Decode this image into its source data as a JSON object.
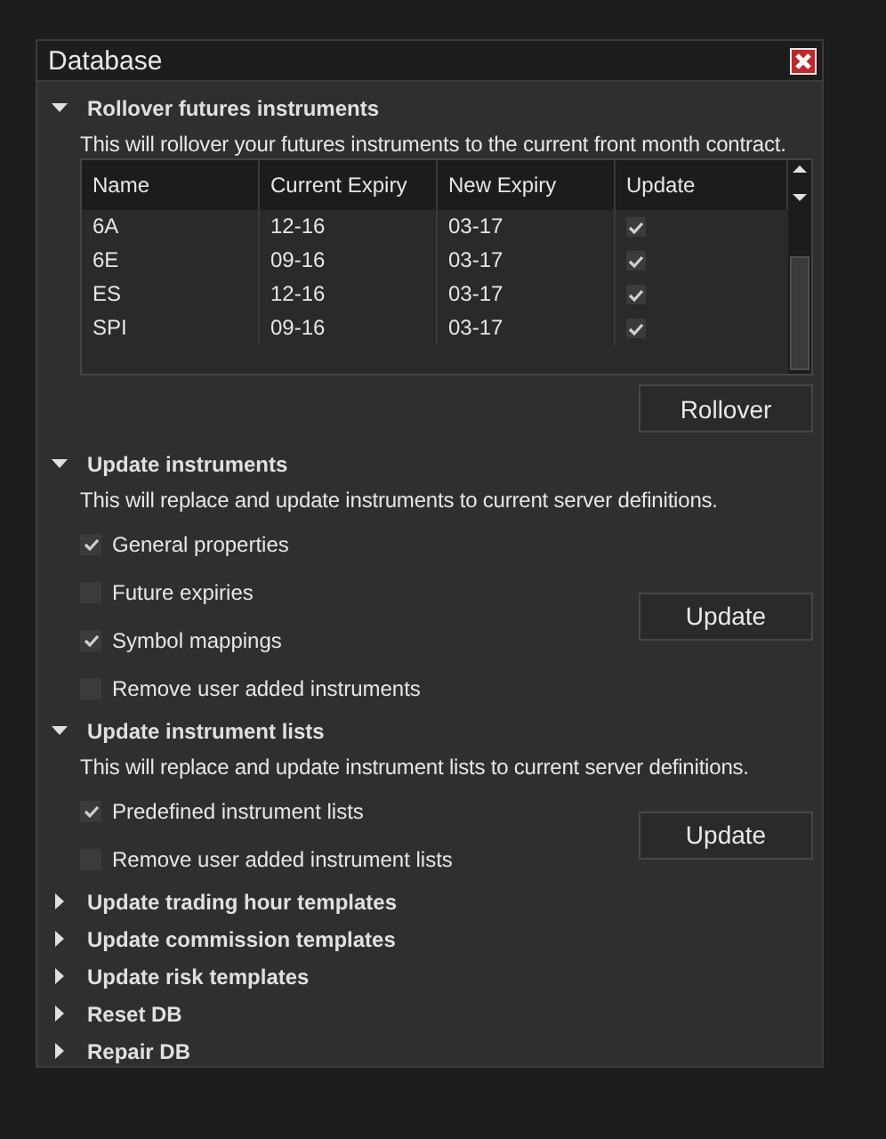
{
  "window": {
    "title": "Database"
  },
  "sections": [
    {
      "title": "Rollover futures instruments",
      "expanded": true,
      "description": "This will rollover your futures instruments to the current front month contract.",
      "table": {
        "columns": [
          "Name",
          "Current Expiry",
          "New Expiry",
          "Update"
        ],
        "rows": [
          {
            "name": "6A",
            "current_expiry": "12-16",
            "new_expiry": "03-17",
            "update": true
          },
          {
            "name": "6E",
            "current_expiry": "09-16",
            "new_expiry": "03-17",
            "update": true
          },
          {
            "name": "ES",
            "current_expiry": "12-16",
            "new_expiry": "03-17",
            "update": true
          },
          {
            "name": "SPI",
            "current_expiry": "09-16",
            "new_expiry": "03-17",
            "update": true
          }
        ]
      },
      "button": "Rollover"
    },
    {
      "title": "Update instruments",
      "expanded": true,
      "description": "This will replace and update instruments to current server definitions.",
      "options": [
        {
          "label": "General properties",
          "checked": true
        },
        {
          "label": "Future expiries",
          "checked": false
        },
        {
          "label": "Symbol mappings",
          "checked": true
        },
        {
          "label": "Remove user added instruments",
          "checked": false
        }
      ],
      "button": "Update"
    },
    {
      "title": "Update instrument lists",
      "expanded": true,
      "description": "This will replace and update instrument lists to current server definitions.",
      "options": [
        {
          "label": "Predefined instrument lists",
          "checked": true
        },
        {
          "label": "Remove user added instrument lists",
          "checked": false
        }
      ],
      "button": "Update"
    },
    {
      "title": "Update trading hour templates",
      "expanded": false
    },
    {
      "title": "Update commission templates",
      "expanded": false
    },
    {
      "title": "Update risk templates",
      "expanded": false
    },
    {
      "title": "Reset DB",
      "expanded": false
    },
    {
      "title": "Repair DB",
      "expanded": false
    }
  ]
}
